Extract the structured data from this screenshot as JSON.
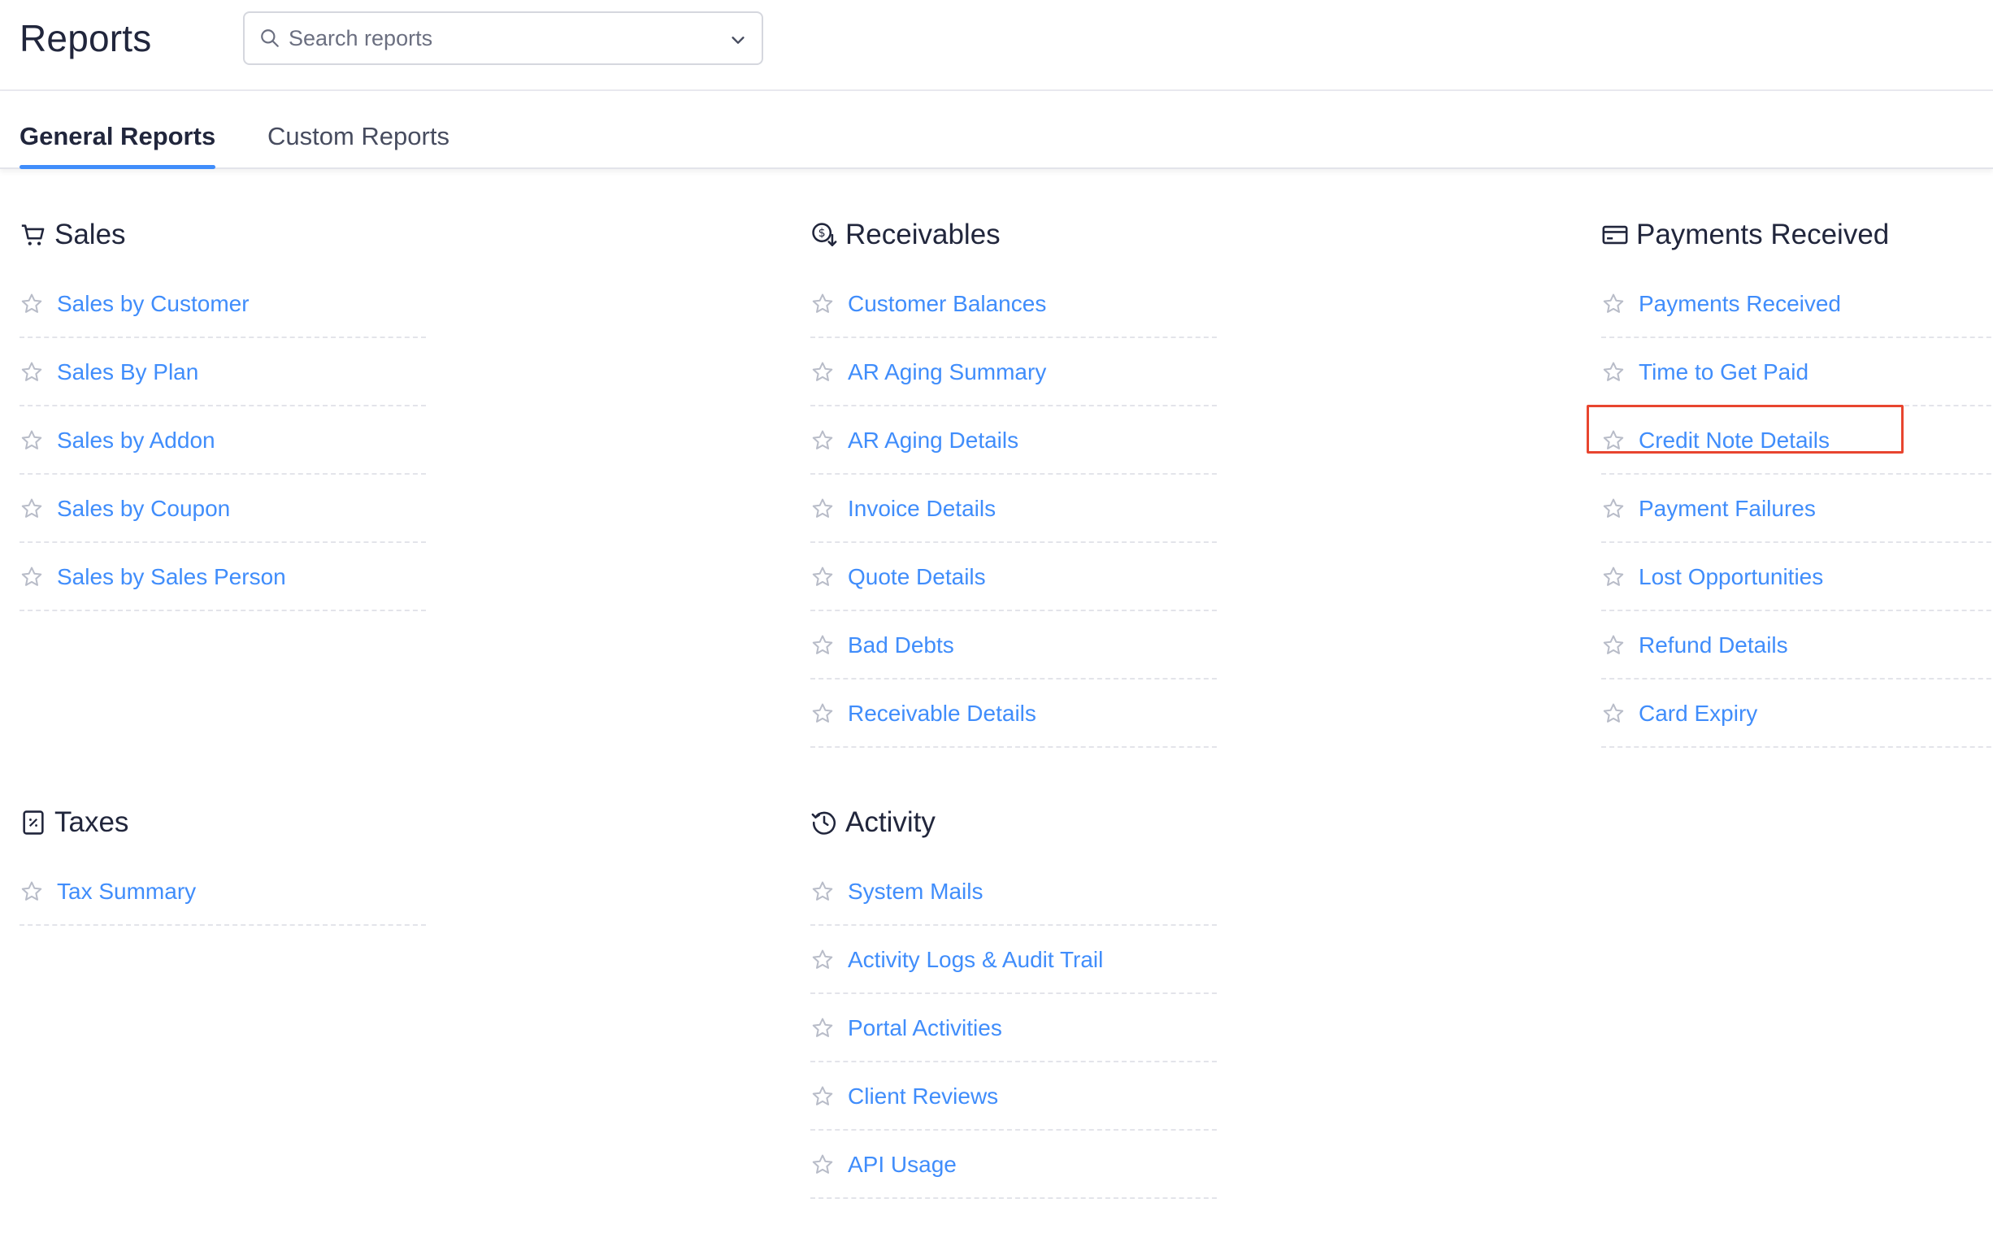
{
  "header": {
    "title": "Reports",
    "search": {
      "placeholder": "Search reports",
      "value": ""
    }
  },
  "tabs": [
    {
      "label": "General Reports",
      "active": true
    },
    {
      "label": "Custom Reports",
      "active": false
    }
  ],
  "sections": {
    "sales": {
      "title": "Sales",
      "icon": "cart-icon",
      "items": [
        "Sales by Customer",
        "Sales By Plan",
        "Sales by Addon",
        "Sales by Coupon",
        "Sales by Sales Person"
      ]
    },
    "receivables": {
      "title": "Receivables",
      "icon": "receivables-icon",
      "items": [
        "Customer Balances",
        "AR Aging Summary",
        "AR Aging Details",
        "Invoice Details",
        "Quote Details",
        "Bad Debts",
        "Receivable Details"
      ]
    },
    "payments": {
      "title": "Payments Received",
      "icon": "card-icon",
      "items": [
        "Payments Received",
        "Time to Get Paid",
        "Credit Note Details",
        "Payment Failures",
        "Lost Opportunities",
        "Refund Details",
        "Card Expiry"
      ]
    },
    "taxes": {
      "title": "Taxes",
      "icon": "tax-icon",
      "items": [
        "Tax Summary"
      ]
    },
    "activity": {
      "title": "Activity",
      "icon": "clock-icon",
      "items": [
        "System Mails",
        "Activity Logs & Audit Trail",
        "Portal Activities",
        "Client Reviews",
        "API Usage"
      ]
    }
  },
  "highlighted_item": "Credit Note Details",
  "colors": {
    "link": "#408dfb",
    "active_tab_underline": "#408dfb",
    "highlight_border": "#e8452f",
    "text": "#21263c"
  }
}
